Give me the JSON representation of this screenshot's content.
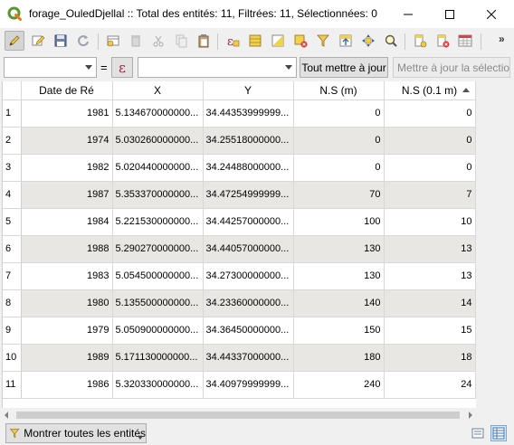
{
  "window": {
    "title": "forage_OuledDjellal :: Total des entités: 11, Filtrées: 11, Sélectionnées: 0",
    "accent": "#589632"
  },
  "toolbar": {
    "icons": [
      "pencil-edit-icon",
      "multi-edit-icon",
      "save-icon",
      "reload-icon",
      "add-feature-icon",
      "delete-icon",
      "cut-icon",
      "copy-icon",
      "paste-icon",
      "expression-select-icon",
      "select-all-icon",
      "invert-selection-icon",
      "deselect-icon",
      "filter-icon",
      "move-to-top-icon",
      "pan-to-selected-icon",
      "zoom-to-selected-icon",
      "new-field-icon",
      "delete-field-icon",
      "field-calculator-icon"
    ],
    "overflow_label": "»"
  },
  "filter": {
    "field_value": "",
    "equals": "=",
    "expression_glyph": "ε",
    "value": "",
    "update_all_label": "Tout mettre à jour",
    "update_selected_label": "Mettre à jour la sélection"
  },
  "table": {
    "columns": [
      "Date de Ré",
      "X",
      "Y",
      "N.S (m)",
      "N.S (0.1 m)"
    ],
    "sorted_column": "N.S (0.1 m)",
    "rows": [
      {
        "n": "1",
        "date": "1981",
        "x": "5.134670000000...",
        "y": "34.44353999999...",
        "ns_m": "0",
        "ns_01": "0"
      },
      {
        "n": "2",
        "date": "1974",
        "x": "5.030260000000...",
        "y": "34.25518000000...",
        "ns_m": "0",
        "ns_01": "0"
      },
      {
        "n": "3",
        "date": "1982",
        "x": "5.020440000000...",
        "y": "34.24488000000...",
        "ns_m": "0",
        "ns_01": "0"
      },
      {
        "n": "4",
        "date": "1987",
        "x": "5.353370000000...",
        "y": "34.47254999999...",
        "ns_m": "70",
        "ns_01": "7"
      },
      {
        "n": "5",
        "date": "1984",
        "x": "5.221530000000...",
        "y": "34.44257000000...",
        "ns_m": "100",
        "ns_01": "10"
      },
      {
        "n": "6",
        "date": "1988",
        "x": "5.290270000000...",
        "y": "34.44057000000...",
        "ns_m": "130",
        "ns_01": "13"
      },
      {
        "n": "7",
        "date": "1983",
        "x": "5.054500000000...",
        "y": "34.27300000000...",
        "ns_m": "130",
        "ns_01": "13"
      },
      {
        "n": "8",
        "date": "1980",
        "x": "5.135500000000...",
        "y": "34.23360000000...",
        "ns_m": "140",
        "ns_01": "14"
      },
      {
        "n": "9",
        "date": "1979",
        "x": "5.050900000000...",
        "y": "34.36450000000...",
        "ns_m": "150",
        "ns_01": "15"
      },
      {
        "n": "10",
        "date": "1989",
        "x": "5.171130000000...",
        "y": "34.44337000000...",
        "ns_m": "180",
        "ns_01": "18"
      },
      {
        "n": "11",
        "date": "1986",
        "x": "5.320330000000...",
        "y": "34.40979999999...",
        "ns_m": "240",
        "ns_01": "24"
      }
    ]
  },
  "bottom": {
    "show_all_label": "Montrer toutes les entités",
    "view_icons": [
      "form-view-icon",
      "table-view-icon"
    ]
  }
}
